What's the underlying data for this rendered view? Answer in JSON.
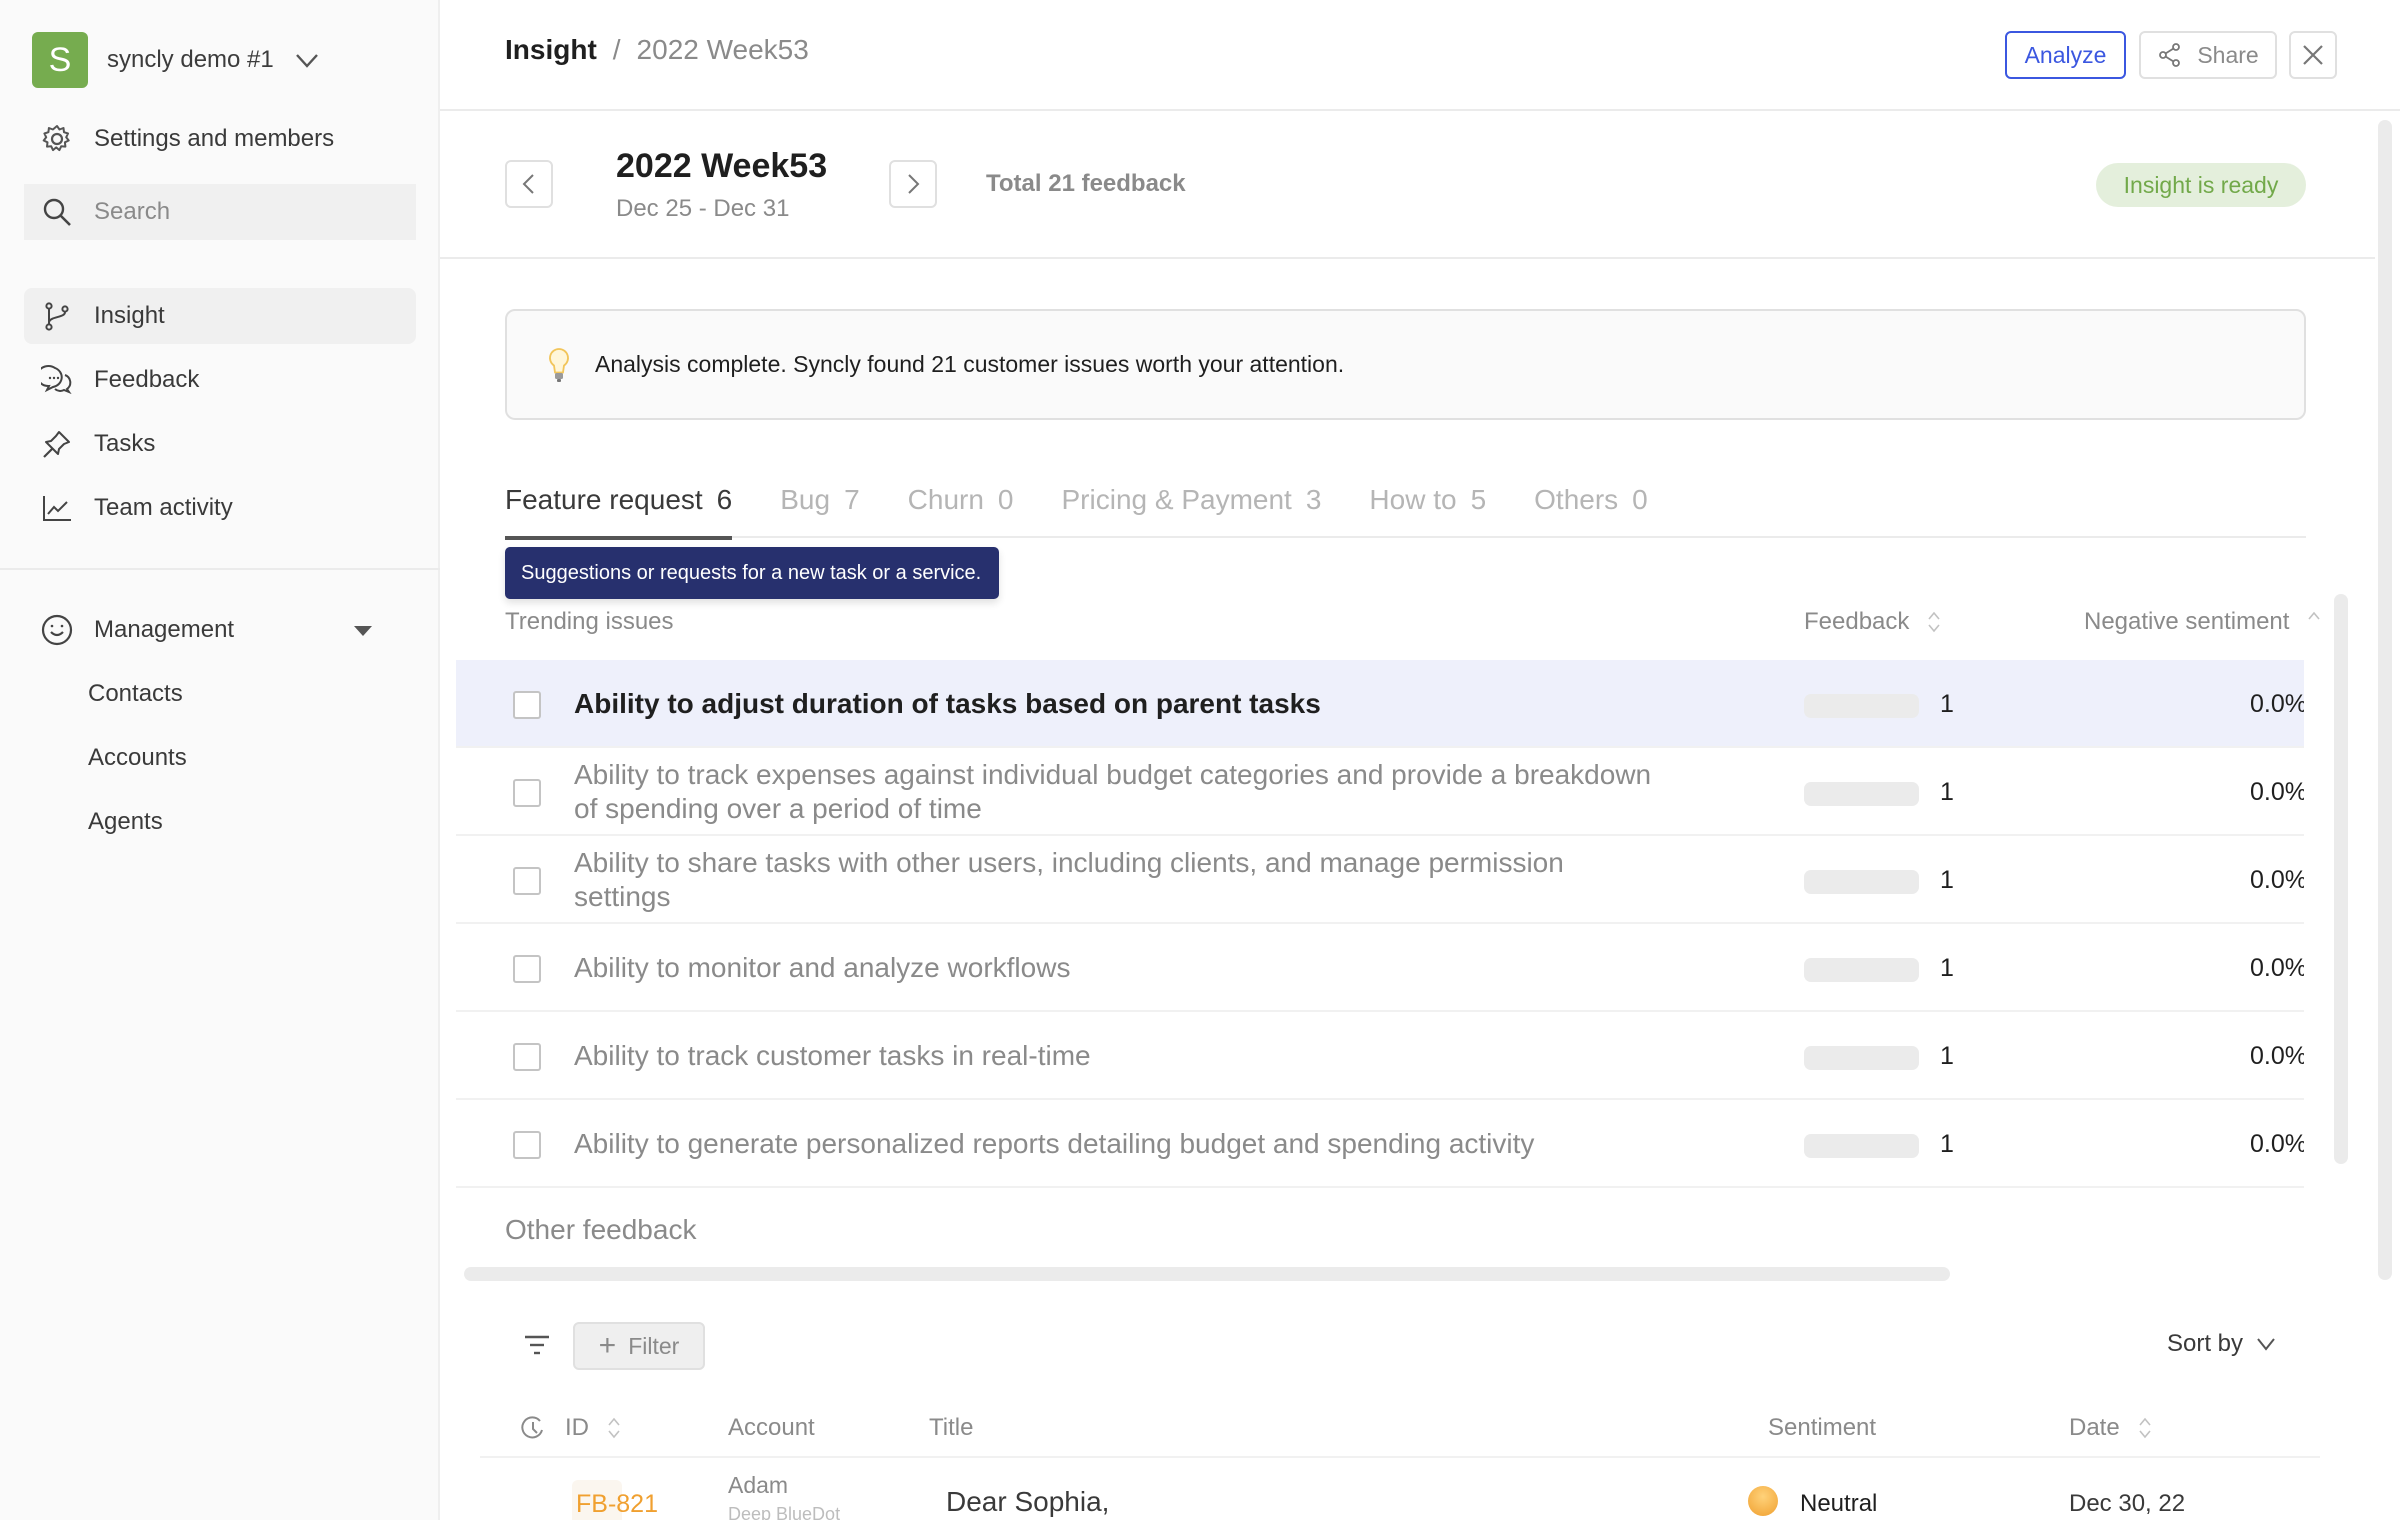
{
  "workspace": {
    "initial": "S",
    "name": "syncly demo #1",
    "logo_color": "#76ac4f"
  },
  "sidebar": {
    "settings_label": "Settings and members",
    "search_placeholder": "Search",
    "nav": [
      {
        "label": "Insight",
        "icon": "insight-branch-icon",
        "active": true
      },
      {
        "label": "Feedback",
        "icon": "chat-bubbles-icon",
        "active": false
      },
      {
        "label": "Tasks",
        "icon": "pin-icon",
        "active": false
      },
      {
        "label": "Team activity",
        "icon": "line-chart-icon",
        "active": false
      }
    ],
    "management": {
      "label": "Management",
      "icon": "smiley-icon",
      "expanded": true,
      "items": [
        "Contacts",
        "Accounts",
        "Agents"
      ]
    }
  },
  "header": {
    "breadcrumb": [
      "Insight",
      "2022 Week53"
    ],
    "separator": "/",
    "analyze_label": "Analyze",
    "share_label": "Share",
    "accent_color": "#3b57e0"
  },
  "week": {
    "title": "2022 Week53",
    "range": "Dec 25 - Dec 31",
    "total": "Total 21 feedback",
    "status": "Insight is ready",
    "status_color": "#72a94a"
  },
  "alert": {
    "icon": "lightbulb-icon",
    "text": "Analysis complete. Syncly found 21 customer issues worth your attention."
  },
  "tabs": [
    {
      "label": "Feature request",
      "count": "6",
      "active": true
    },
    {
      "label": "Bug",
      "count": "7",
      "active": false
    },
    {
      "label": "Churn",
      "count": "0",
      "active": false
    },
    {
      "label": "Pricing & Payment",
      "count": "3",
      "active": false
    },
    {
      "label": "How to",
      "count": "5",
      "active": false
    },
    {
      "label": "Others",
      "count": "0",
      "active": false
    }
  ],
  "tooltip": "Suggestions or requests for a new task or a service.",
  "trending": {
    "header": {
      "issues": "Trending issues",
      "feedback": "Feedback",
      "negative": "Negative sentiment"
    },
    "rows": [
      {
        "title": "Ability to adjust duration of tasks based on parent tasks",
        "feedback": "1",
        "feedback_fraction": 0.0,
        "negative": "0.0%",
        "highlighted": true
      },
      {
        "title": "Ability to track expenses against individual budget categories and provide a breakdown of spending over a period of time",
        "feedback": "1",
        "feedback_fraction": 0.0,
        "negative": "0.0%",
        "highlighted": false
      },
      {
        "title": "Ability to share tasks with other users, including clients, and manage permission settings",
        "feedback": "1",
        "feedback_fraction": 0.0,
        "negative": "0.0%",
        "highlighted": false
      },
      {
        "title": "Ability to monitor and analyze workflows",
        "feedback": "1",
        "feedback_fraction": 0.0,
        "negative": "0.0%",
        "highlighted": false
      },
      {
        "title": "Ability to track customer tasks in real-time",
        "feedback": "1",
        "feedback_fraction": 0.0,
        "negative": "0.0%",
        "highlighted": false
      },
      {
        "title": "Ability to generate personalized reports detailing budget and spending activity",
        "feedback": "1",
        "feedback_fraction": 0.0,
        "negative": "0.0%",
        "highlighted": false
      }
    ]
  },
  "other_feedback": {
    "label": "Other feedback",
    "filter_label": "Filter",
    "sort_label": "Sort by",
    "columns": {
      "id": "ID",
      "account": "Account",
      "title": "Title",
      "sentiment": "Sentiment",
      "date": "Date"
    },
    "rows": [
      {
        "id": "FB-821",
        "account": "Adam",
        "organization": "Deep BlueDot",
        "title": "Dear Sophia,",
        "sentiment": "Neutral",
        "date": "Dec 30, 22"
      }
    ]
  }
}
